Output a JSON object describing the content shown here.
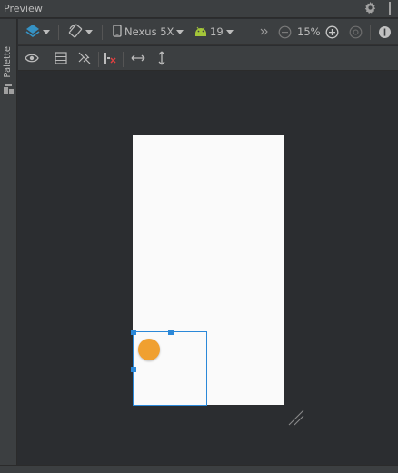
{
  "window": {
    "title": "Preview"
  },
  "sidebar": {
    "palette_label": "Palette"
  },
  "toolbar": {
    "device": "Nexus 5X",
    "api_level": "19",
    "zoom": "15%"
  },
  "colors": {
    "accent": "#2b88d8",
    "fab": "#f0a030",
    "android_green": "#a4c639",
    "layer_blue": "#3592c4"
  },
  "icons": {
    "title": [
      "gear-icon",
      "pin-icon"
    ],
    "toolbar1": [
      "layers-icon",
      "rotate-icon",
      "phone-icon",
      "android-icon",
      "more-chevrons-icon",
      "zoom-out-icon",
      "zoom-in-icon",
      "zoom-fit-icon",
      "warning-icon"
    ],
    "toolbar2": [
      "eye-icon",
      "blueprint-icon",
      "constraints-icon",
      "clear-constraints-icon",
      "expand-horizontal-icon",
      "expand-vertical-icon"
    ]
  }
}
